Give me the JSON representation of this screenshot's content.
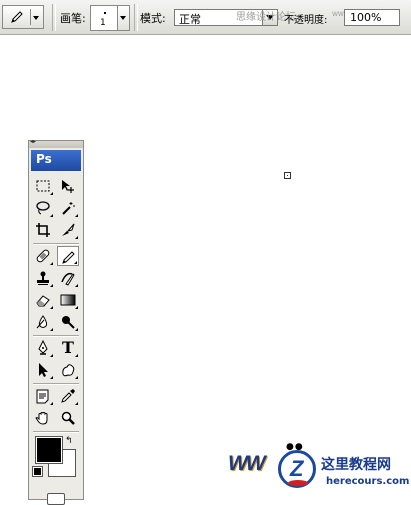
{
  "options_bar": {
    "brush_label": "画笔:",
    "brush_size": "1",
    "mode_label": "模式:",
    "mode_value": "正常",
    "watermark_text": "思缘设计论坛",
    "watermark_url": "WWW.MISSYUAN.COM",
    "opacity_label": "不透明度:",
    "opacity_value": "100%"
  },
  "toolbox": {
    "logo": "Ps",
    "text_tool_glyph": "T"
  },
  "watermark_logo": {
    "ww": "WW",
    "z": "Z",
    "eyes": "●● ",
    "cn": "这里教程网",
    "en": "herecours.com"
  },
  "colors": {
    "foreground": "#000000",
    "background": "#ffffff",
    "ps_blue": "#2a5cc0"
  }
}
